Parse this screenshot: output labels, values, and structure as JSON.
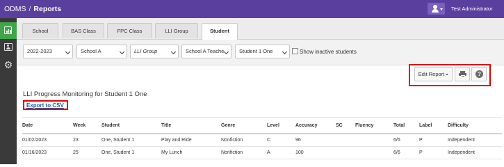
{
  "header": {
    "app_name": "ODMS",
    "separator": "/",
    "page": "Reports",
    "user_name": "Test Administrator",
    "user_icon": "user-icon"
  },
  "sidebar": {
    "items": [
      {
        "icon": "bar-chart-icon",
        "active": true
      },
      {
        "icon": "id-card-icon",
        "active": false
      },
      {
        "icon": "gear-icon",
        "active": false
      }
    ]
  },
  "tabs": [
    {
      "label": "School"
    },
    {
      "label": "BAS Class"
    },
    {
      "label": "FPC Class"
    },
    {
      "label": "LLI Group"
    },
    {
      "label": "Student",
      "active": true
    }
  ],
  "filters": {
    "year": "2022-2023",
    "school": "School A",
    "group": "LLI Group",
    "teacher": "School A Teache",
    "student": "Student 1 One",
    "inactive_label": "Show inactive students",
    "inactive_checked": false
  },
  "toolbar": {
    "edit_report": "Edit Report",
    "print_icon": "print-icon",
    "help_icon": "help-icon",
    "help_glyph": "?"
  },
  "report": {
    "title": "LLI Progress Monitoring for Student 1 One",
    "export_label": "Export to CSV"
  },
  "table": {
    "columns": [
      "Date",
      "Week",
      "Student",
      "Title",
      "Genre",
      "Level",
      "Accuracy",
      "SC",
      "Fluency",
      "Total",
      "Label",
      "Difficulty"
    ],
    "rows": [
      [
        "01/02/2023",
        "23",
        "One, Student 1",
        "Play and Ride",
        "Nonfiction",
        "C",
        "96",
        "",
        "",
        "6/6",
        "P",
        "Independent"
      ],
      [
        "01/16/2023",
        "25",
        "One, Student 1",
        "My Lunch",
        "Nonfiction",
        "A",
        "100",
        "",
        "",
        "6/6",
        "P",
        "Independent"
      ]
    ]
  },
  "colors": {
    "topbar": "#5b3f9e",
    "sidebar": "#3a3a3a",
    "sidebar_active": "#3fa64a",
    "highlight": "#e00000",
    "link": "#1a5fb4"
  }
}
